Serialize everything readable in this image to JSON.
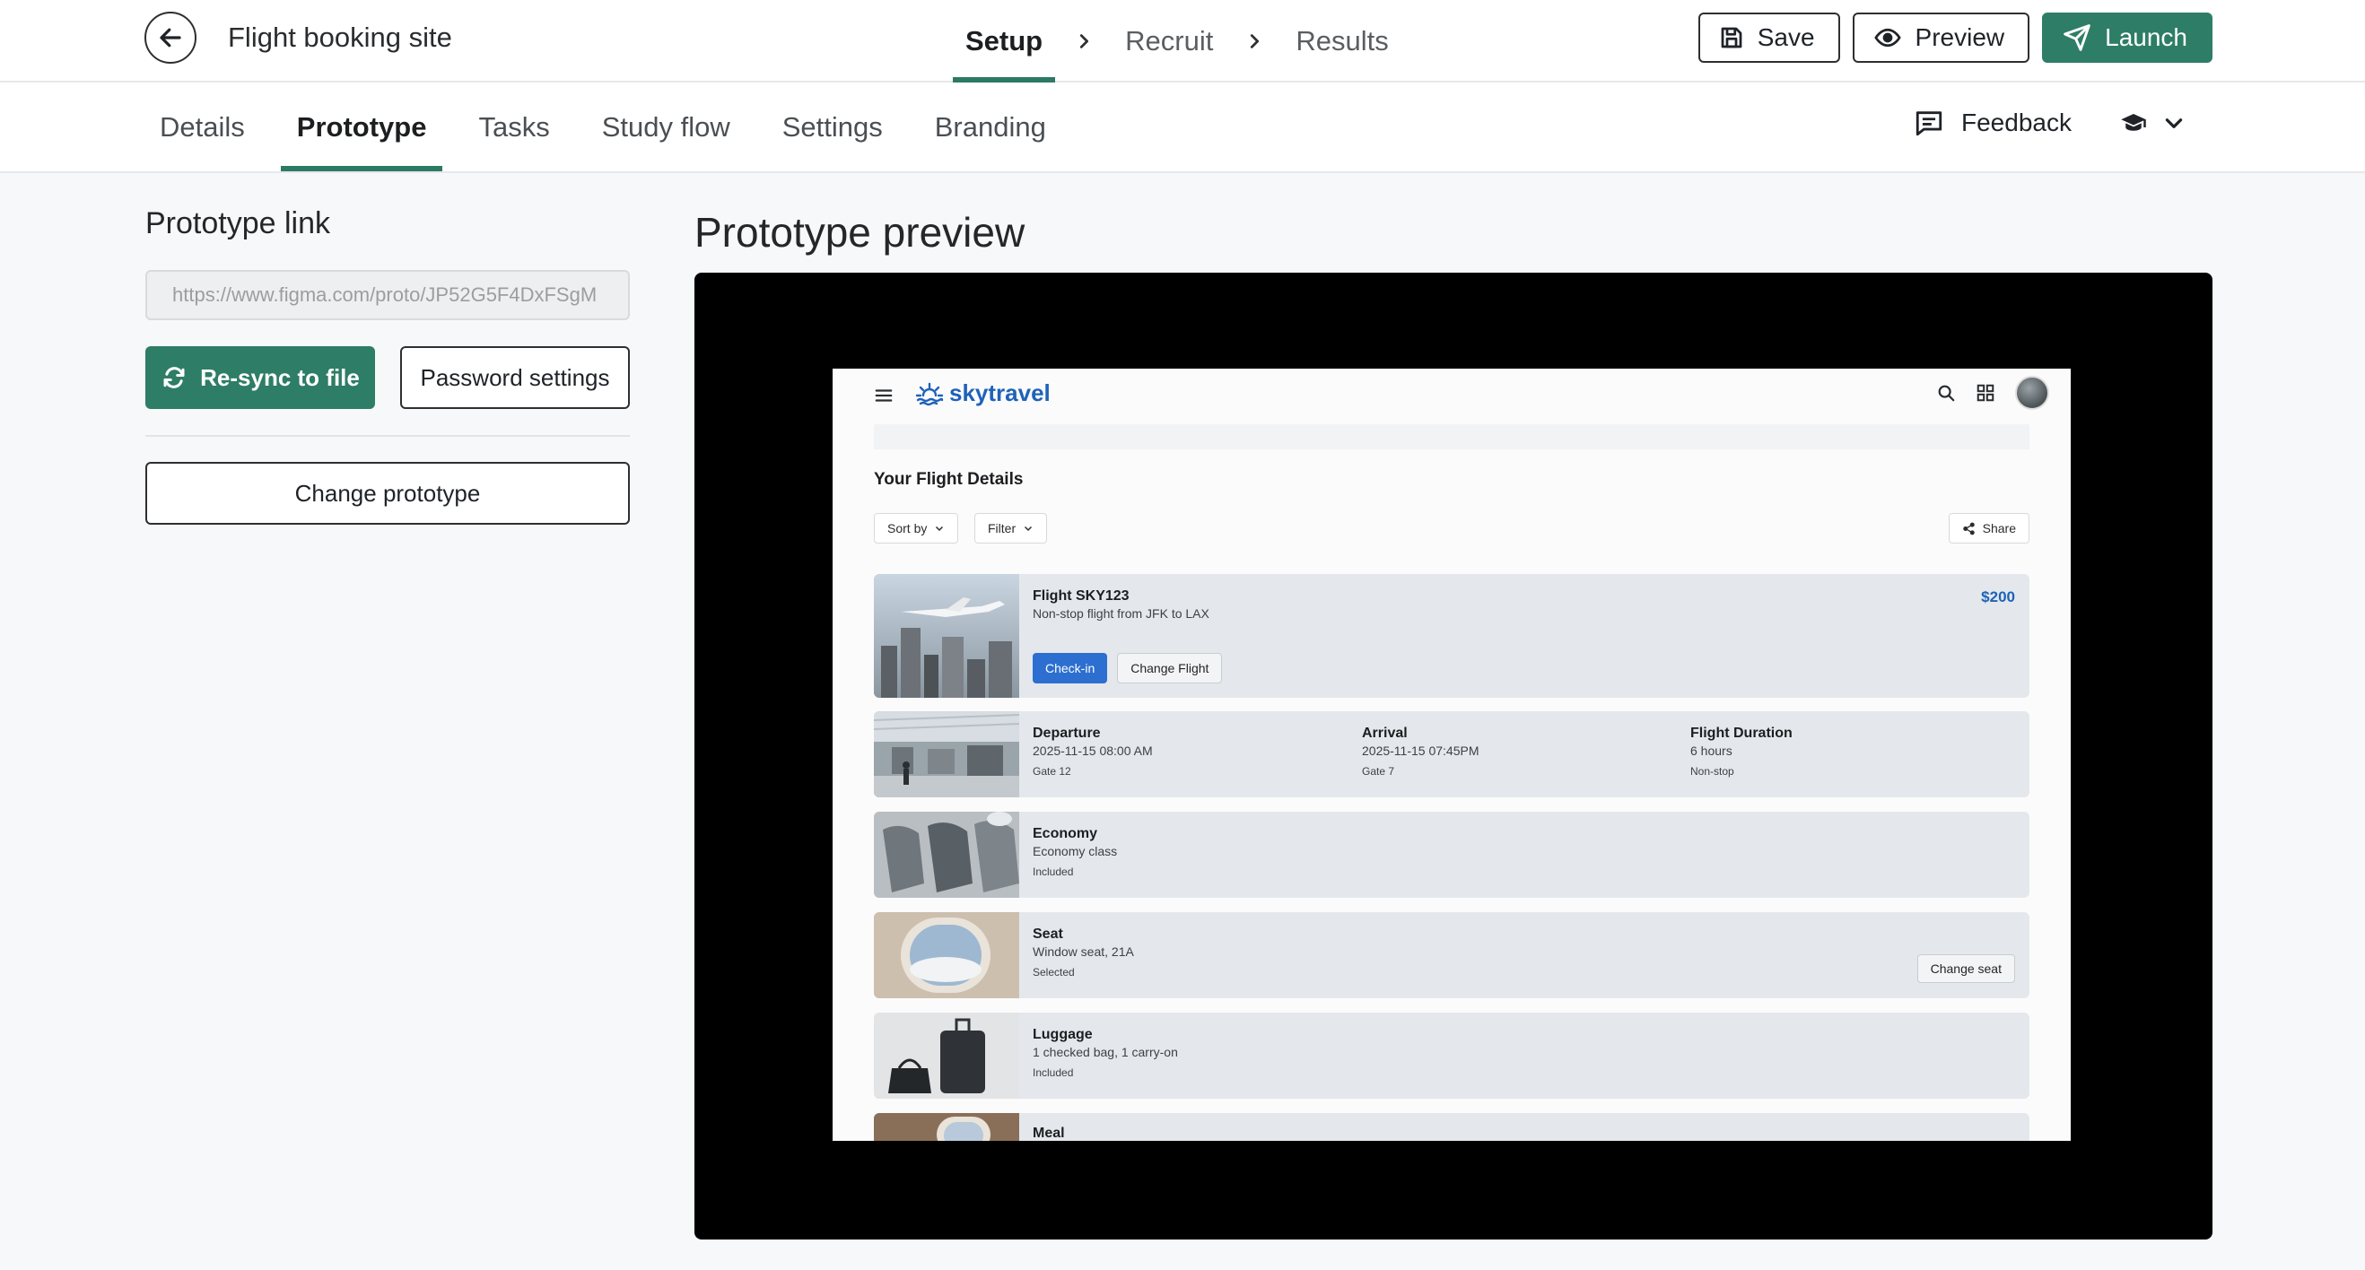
{
  "header": {
    "title": "Flight booking site",
    "steps": [
      "Setup",
      "Recruit",
      "Results"
    ],
    "save_label": "Save",
    "preview_label": "Preview",
    "launch_label": "Launch"
  },
  "subnav": {
    "tabs": [
      "Details",
      "Prototype",
      "Tasks",
      "Study flow",
      "Settings",
      "Branding"
    ],
    "feedback_label": "Feedback"
  },
  "left_panel": {
    "title": "Prototype link",
    "link_value": "https://www.figma.com/proto/JP52G5F4DxFSgM",
    "resync_label": "Re-sync to file",
    "password_label": "Password settings",
    "change_label": "Change prototype"
  },
  "preview": {
    "title": "Prototype preview",
    "brand": "skytravel",
    "page_title": "Your Flight Details",
    "sort_label": "Sort by",
    "filter_label": "Filter",
    "share_label": "Share",
    "flight": {
      "name": "Flight SKY123",
      "desc": "Non-stop flight from JFK to LAX",
      "price": "$200",
      "checkin_label": "Check-in",
      "change_label": "Change Flight"
    },
    "schedule": {
      "departure_title": "Departure",
      "departure_time": "2025-11-15 08:00 AM",
      "departure_gate": "Gate 12",
      "arrival_title": "Arrival",
      "arrival_time": "2025-11-15 07:45PM",
      "arrival_gate": "Gate 7",
      "duration_title": "Flight Duration",
      "duration_value": "6 hours",
      "duration_note": "Non-stop"
    },
    "economy": {
      "title": "Economy",
      "sub": "Economy class",
      "note": "Included"
    },
    "seat": {
      "title": "Seat",
      "sub": "Window seat, 21A",
      "note": "Selected",
      "button": "Change seat"
    },
    "luggage": {
      "title": "Luggage",
      "sub": "1 checked bag, 1 carry-on",
      "note": "Included"
    },
    "meal": {
      "title": "Meal"
    }
  },
  "colors": {
    "accent": "#2e7d66",
    "brand_blue": "#1f62b8",
    "checkin_blue": "#2c6fd0"
  }
}
